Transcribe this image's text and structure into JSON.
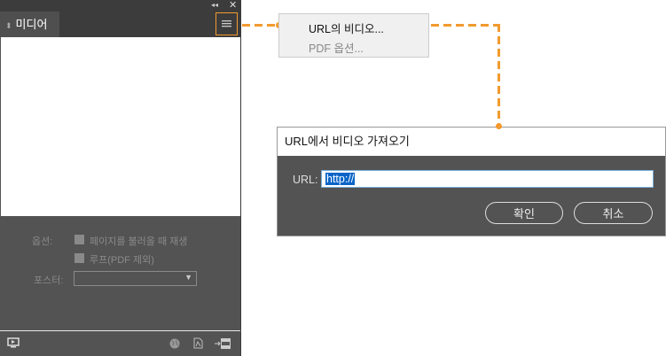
{
  "panel": {
    "tab_title": "미디어",
    "options_label": "옵션:",
    "option_play_on_load": "페이지를 불러올 때 재생",
    "option_loop": "루프(PDF 제외)",
    "poster_label": "포스터:",
    "poster_value": ""
  },
  "flyout_menu": {
    "items": [
      {
        "label": "URL의 비디오..."
      },
      {
        "label": "PDF 옵션..."
      }
    ]
  },
  "dialog": {
    "title": "URL에서 비디오 가져오기",
    "url_label": "URL:",
    "url_value": "http://",
    "ok_label": "확인",
    "cancel_label": "취소"
  },
  "colors": {
    "callout": "#f29a2e",
    "panel": "#535353",
    "selection": "#0a64c8"
  }
}
